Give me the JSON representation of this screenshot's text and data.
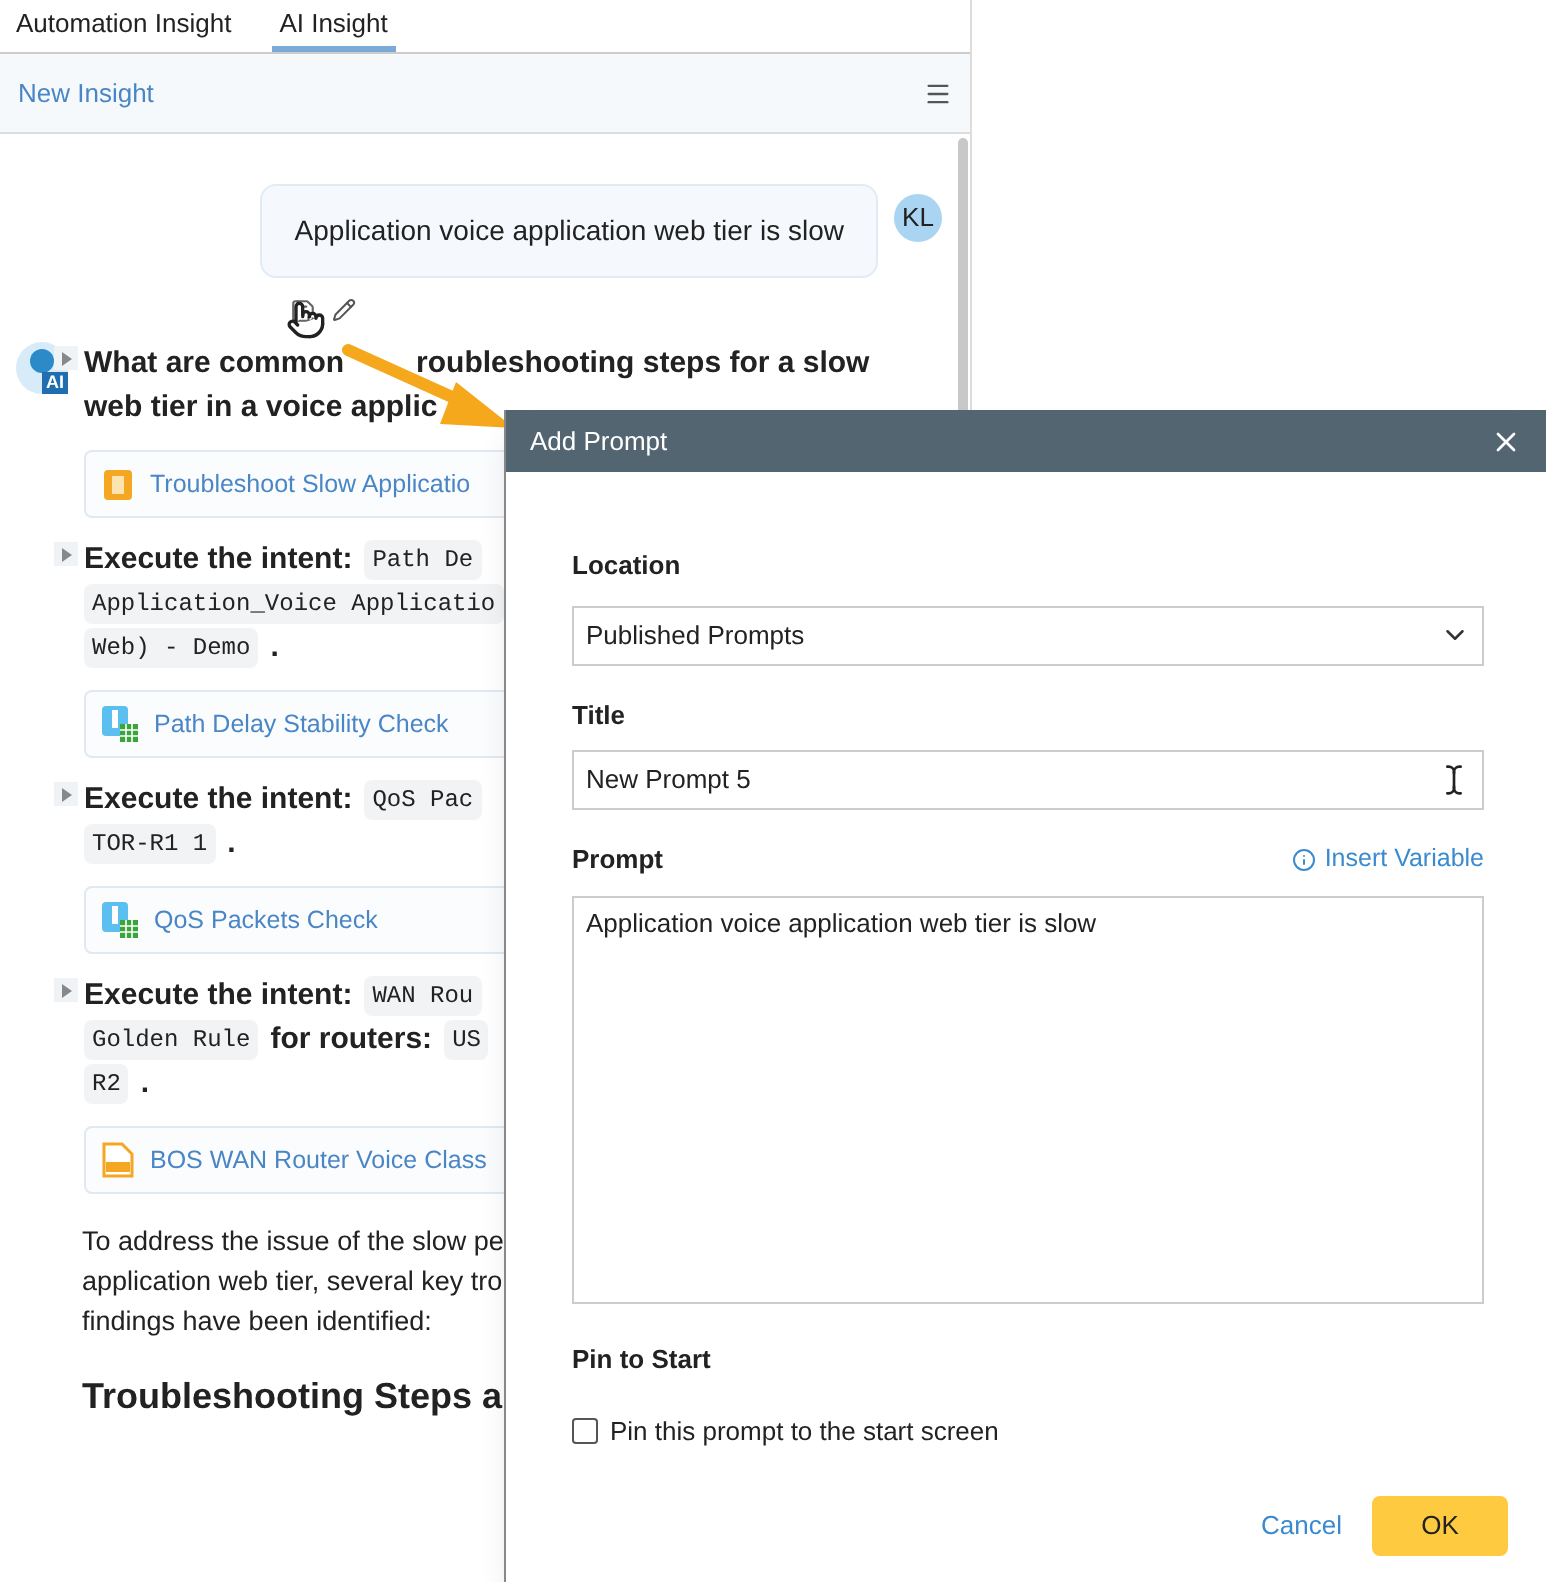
{
  "tabs": [
    {
      "label": "Automation Insight",
      "selected": false
    },
    {
      "label": "AI Insight",
      "selected": true
    }
  ],
  "header": {
    "title": "New Insight"
  },
  "user_message": {
    "avatar": "KL",
    "text": "Application voice application web tier is slow"
  },
  "ai_badge": "AI",
  "steps": [
    {
      "lines": [
        [
          {
            "kind": "heading",
            "text": "What are common"
          },
          {
            "kind": "gap"
          },
          {
            "kind": "heading",
            "text": "roubleshooting steps for a slow"
          }
        ],
        [
          {
            "kind": "heading",
            "text": "web tier in a voice applic"
          }
        ]
      ],
      "card": {
        "kind": "runbook",
        "label": "Troubleshoot Slow Applicatio"
      }
    },
    {
      "lines": [
        [
          {
            "kind": "text",
            "text": "Execute the intent:"
          },
          {
            "kind": "code",
            "text": "Path De"
          }
        ],
        [
          {
            "kind": "code",
            "text": "Application_Voice Applicatio"
          }
        ],
        [
          {
            "kind": "code",
            "text": "Web) - Demo"
          },
          {
            "kind": "text",
            "text": "."
          }
        ]
      ],
      "card": {
        "kind": "intent",
        "label": "Path Delay Stability Check"
      }
    },
    {
      "lines": [
        [
          {
            "kind": "text",
            "text": "Execute the intent:"
          },
          {
            "kind": "code",
            "text": "QoS Pac"
          }
        ],
        [
          {
            "kind": "code",
            "text": "TOR-R1 1"
          },
          {
            "kind": "text",
            "text": "."
          }
        ]
      ],
      "card": {
        "kind": "intent",
        "label": "QoS Packets Check"
      }
    },
    {
      "lines": [
        [
          {
            "kind": "text",
            "text": "Execute the intent:"
          },
          {
            "kind": "code",
            "text": "WAN Rou"
          }
        ],
        [
          {
            "kind": "code",
            "text": "Golden Rule"
          },
          {
            "kind": "text",
            "text": "for routers:"
          },
          {
            "kind": "code",
            "text": "US"
          }
        ],
        [
          {
            "kind": "code",
            "text": "R2"
          },
          {
            "kind": "text",
            "text": "."
          }
        ]
      ],
      "card": {
        "kind": "config",
        "label": "BOS WAN Router Voice Class"
      }
    }
  ],
  "summary_lines": [
    "To address the issue of the slow pe",
    "application web tier, several key tro",
    "findings have been identified:"
  ],
  "section_heading": "Troubleshooting Steps a",
  "dialog": {
    "title": "Add Prompt",
    "location": {
      "label": "Location",
      "value": "Published Prompts"
    },
    "title_field": {
      "label": "Title",
      "value": "New Prompt 5"
    },
    "prompt": {
      "label": "Prompt",
      "insert_link": "Insert Variable",
      "value": "Application voice application web tier is slow"
    },
    "pin": {
      "label": "Pin to Start",
      "option": "Pin this prompt to the start screen",
      "checked": false
    },
    "buttons": {
      "cancel": "Cancel",
      "ok": "OK"
    }
  }
}
